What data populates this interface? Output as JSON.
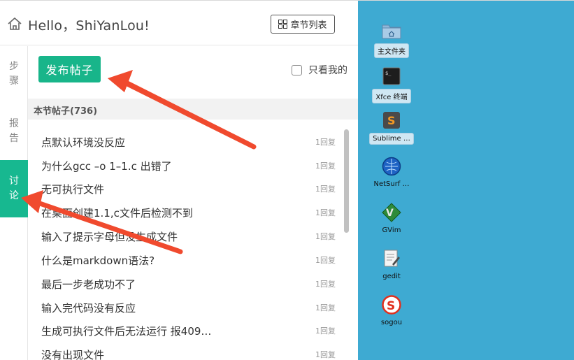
{
  "header": {
    "greeting": "Hello，ShiYanLou!",
    "chapter_list_label": "章节列表"
  },
  "tabs": {
    "steps": [
      "步",
      "骤"
    ],
    "report": [
      "报",
      "告"
    ],
    "discuss": [
      "讨",
      "论"
    ]
  },
  "toolbar": {
    "post_button": "发布帖子",
    "only_mine": "只看我的"
  },
  "section": {
    "title": "本节帖子(736)"
  },
  "posts": [
    {
      "title": "点默认环境没反应",
      "replies": "1回复"
    },
    {
      "title": "为什么gcc –o 1–1.c 出错了",
      "replies": "1回复"
    },
    {
      "title": "无可执行文件",
      "replies": "1回复"
    },
    {
      "title": "在桌面创建1.1,c文件后检测不到",
      "replies": "1回复"
    },
    {
      "title": "输入了提示字母但没生成文件",
      "replies": "1回复"
    },
    {
      "title": "什么是markdown语法?",
      "replies": "1回复"
    },
    {
      "title": "最后一步老成功不了",
      "replies": "1回复"
    },
    {
      "title": "输入完代码没有反应",
      "replies": "1回复"
    },
    {
      "title": "生成可执行文件后无法运行 报409…",
      "replies": "1回复"
    },
    {
      "title": "没有出现文件",
      "replies": "1回复"
    }
  ],
  "desktop": {
    "items": [
      {
        "label": "主文件夹",
        "icon": "folder-home-icon"
      },
      {
        "label": "Xfce 终端",
        "icon": "terminal-icon"
      },
      {
        "label": "Sublime …",
        "icon": "sublime-icon"
      },
      {
        "label": "NetSurf …",
        "icon": "netsurf-icon"
      },
      {
        "label": "GVim",
        "icon": "gvim-icon"
      },
      {
        "label": "gedit",
        "icon": "gedit-icon"
      },
      {
        "label": "sogou",
        "icon": "sogou-icon"
      }
    ]
  },
  "colors": {
    "accent": "#18b58a",
    "desktop_bg": "#3eaad2",
    "arrow": "#f04a2e"
  }
}
